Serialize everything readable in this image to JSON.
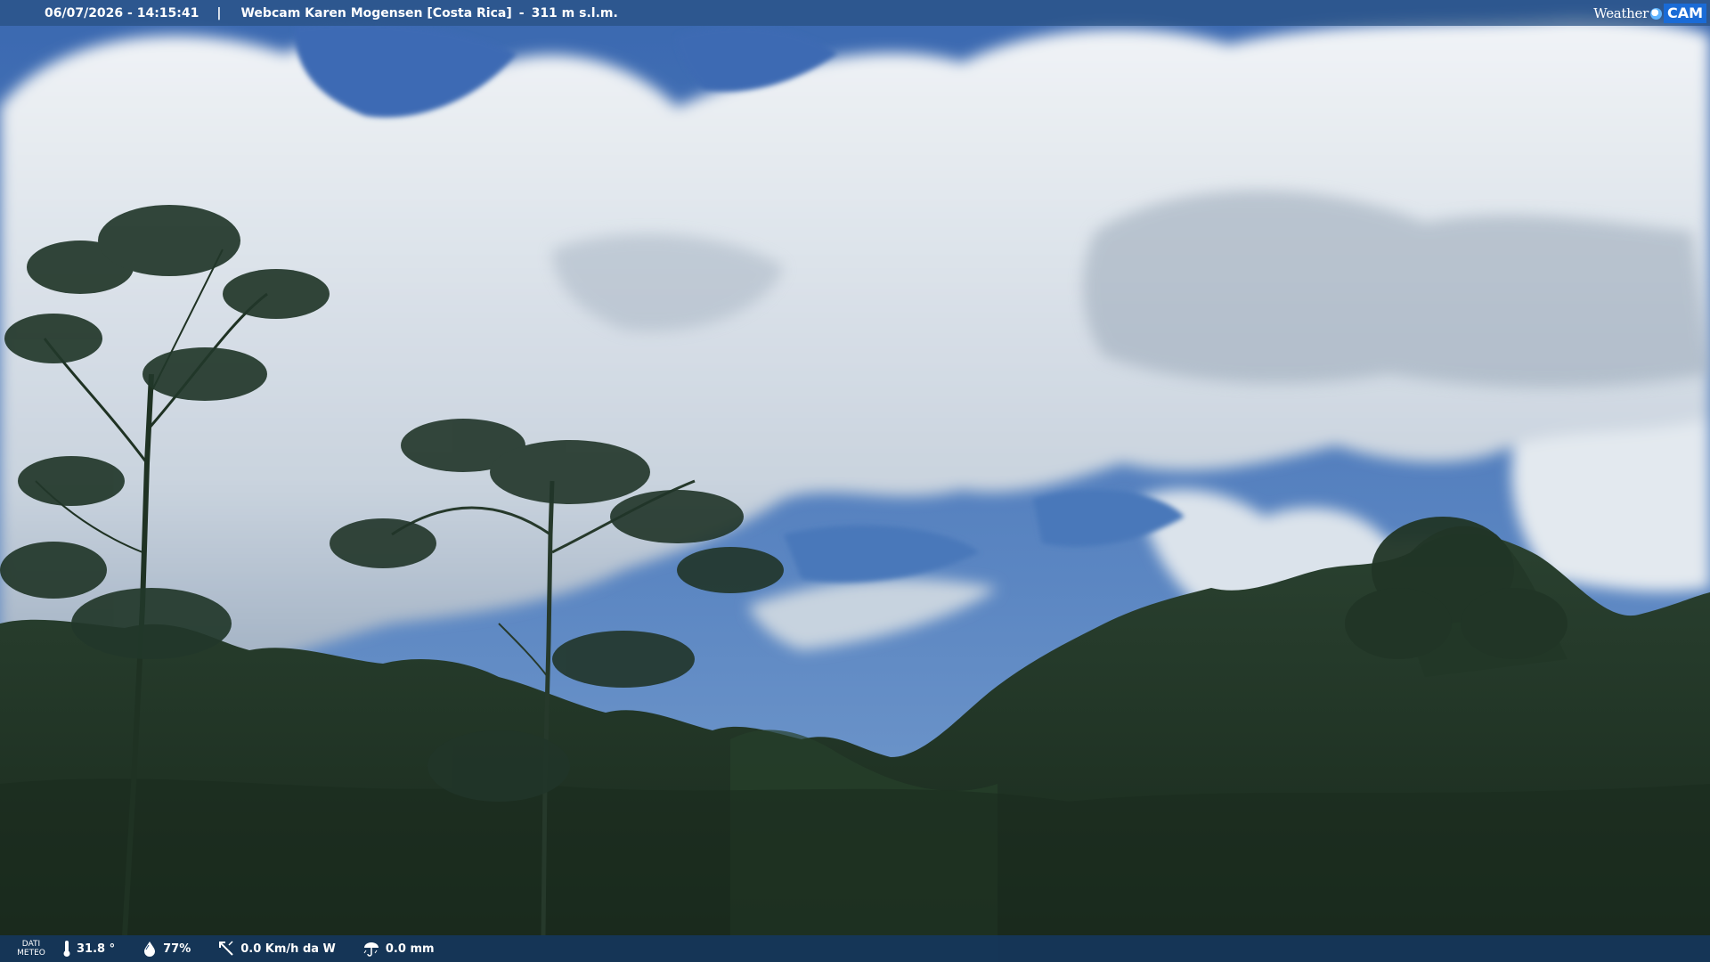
{
  "header": {
    "timestamp": "06/07/2026 - 14:15:41",
    "separator": "|",
    "webcam_name": "Webcam Karen Mogensen [Costa Rica]",
    "dash": "-",
    "altitude": "311 m s.l.m."
  },
  "logo": {
    "weather_text": "Weather",
    "cam_text": "CAM",
    "icon": "globe-dot-icon"
  },
  "footer": {
    "label_line1": "DATI",
    "label_line2": "METEO",
    "temperature": "31.8 °",
    "humidity": "77%",
    "wind": "0.0 Km/h da W",
    "rain": "0.0 mm",
    "icons": [
      "thermometer-icon",
      "humidity-drop-icon",
      "wind-icon",
      "rain-icon"
    ]
  },
  "colors": {
    "sky_top": "#3d6fb8",
    "sky_low": "#6b93c7",
    "cloud": "#e7edf3",
    "forest": "#1f3322",
    "bar": "#1e4a7a"
  }
}
